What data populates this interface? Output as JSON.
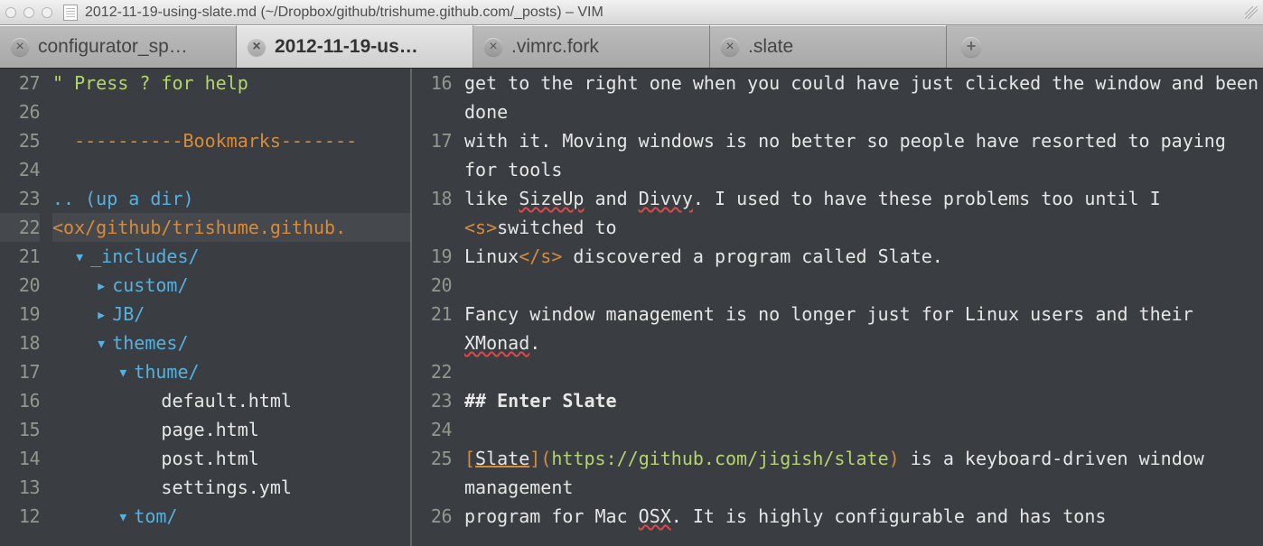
{
  "titlebar": {
    "title": "2012-11-19-using-slate.md (~/Dropbox/github/trishume.github.com/_posts) – VIM"
  },
  "tabs": [
    {
      "label": "configurator_sp…",
      "active": false
    },
    {
      "label": "2012-11-19-us…",
      "active": true
    },
    {
      "label": ".vimrc.fork",
      "active": false
    },
    {
      "label": ".slate",
      "active": false
    }
  ],
  "left": {
    "highlight_index": 5,
    "numbers": [
      "27",
      "26",
      "25",
      "24",
      "23",
      "22",
      "21",
      "20",
      "19",
      "18",
      "17",
      "16",
      "15",
      "14",
      "13",
      "12"
    ],
    "lines": [
      {
        "kind": "comment",
        "text": "\" Press ? for help"
      },
      {
        "kind": "blank",
        "text": ""
      },
      {
        "kind": "bookmarks",
        "dashes_left": "----------",
        "label": "Bookmarks",
        "dashes_right": "-------"
      },
      {
        "kind": "blank",
        "text": ""
      },
      {
        "kind": "updir",
        "prefix": ".. ",
        "text": "(up a dir)"
      },
      {
        "kind": "cwd",
        "text": "<ox/github/trishume.github."
      },
      {
        "kind": "dir-open",
        "indent": 1,
        "name": "_includes/"
      },
      {
        "kind": "dir-closed",
        "indent": 2,
        "name": "custom/"
      },
      {
        "kind": "dir-closed",
        "indent": 2,
        "name": "JB/"
      },
      {
        "kind": "dir-open",
        "indent": 2,
        "name": "themes/"
      },
      {
        "kind": "dir-open",
        "indent": 3,
        "name": "thume/"
      },
      {
        "kind": "file",
        "indent": 4,
        "name": "default.html"
      },
      {
        "kind": "file",
        "indent": 4,
        "name": "page.html"
      },
      {
        "kind": "file",
        "indent": 4,
        "name": "post.html"
      },
      {
        "kind": "file",
        "indent": 4,
        "name": "settings.yml"
      },
      {
        "kind": "dir-open",
        "indent": 3,
        "name": "tom/"
      }
    ]
  },
  "right": {
    "numbers": [
      "16",
      "17",
      "18",
      "19",
      "20",
      "21",
      "22",
      "23",
      "24",
      "25",
      "26"
    ],
    "lines": [
      {
        "tokens": [
          {
            "t": "get to the right one when you could have just clicked the window and been done"
          }
        ],
        "wrap": 2
      },
      {
        "tokens": [
          {
            "t": "with it. Moving windows is no better so people have resorted to paying for tools"
          }
        ],
        "wrap": 2
      },
      {
        "tokens": [
          {
            "t": "like "
          },
          {
            "t": "SizeUp",
            "cls": "spell"
          },
          {
            "t": " and "
          },
          {
            "t": "Divvy",
            "cls": "spell"
          },
          {
            "t": ". I used to have these problems too until I "
          },
          {
            "t": "<s>",
            "cls": "c-html"
          },
          {
            "t": "switched to"
          }
        ],
        "wrap": 2
      },
      {
        "tokens": [
          {
            "t": "Linux"
          },
          {
            "t": "</s>",
            "cls": "c-html"
          },
          {
            "t": " discovered a program called Slate."
          }
        ],
        "wrap": 1
      },
      {
        "tokens": [],
        "wrap": 1
      },
      {
        "tokens": [
          {
            "t": "Fancy window management is no longer just for Linux users and their "
          },
          {
            "t": "XMonad",
            "cls": "spell"
          },
          {
            "t": "."
          }
        ],
        "wrap": 2
      },
      {
        "tokens": [],
        "wrap": 1
      },
      {
        "tokens": [
          {
            "t": "## Enter Slate",
            "cls": "bold"
          }
        ],
        "wrap": 1
      },
      {
        "tokens": [],
        "wrap": 1
      },
      {
        "tokens": [
          {
            "t": "[",
            "cls": "c-brack"
          },
          {
            "t": "Slate",
            "cls": "c-link under"
          },
          {
            "t": "]",
            "cls": "c-brack"
          },
          {
            "t": "(",
            "cls": "c-paren"
          },
          {
            "t": "https://github.com/jigish/slate",
            "cls": "c-url"
          },
          {
            "t": ")",
            "cls": "c-paren"
          },
          {
            "t": " is a keyboard-driven window management"
          }
        ],
        "wrap": 2
      },
      {
        "tokens": [
          {
            "t": "program for Mac "
          },
          {
            "t": "OSX",
            "cls": "spell"
          },
          {
            "t": ". It is highly configurable and has tons"
          }
        ],
        "wrap": 1
      }
    ]
  }
}
